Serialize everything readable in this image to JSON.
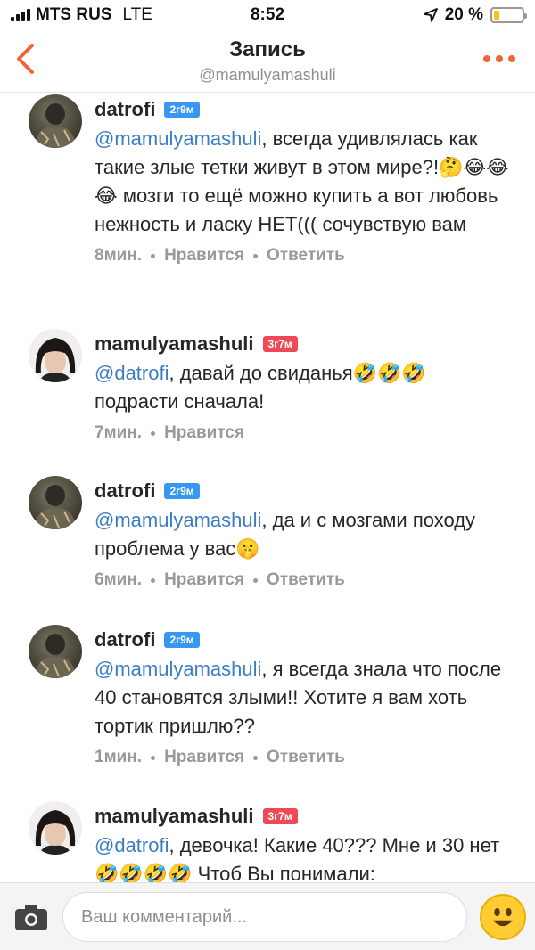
{
  "statusbar": {
    "carrier": "MTS RUS",
    "network": "LTE",
    "time": "8:52",
    "battery_text": "20 %",
    "battery_level": 0.2
  },
  "header": {
    "title": "Запись",
    "subtitle": "@mamulyamashuli"
  },
  "comments": [
    {
      "user": "datrofi",
      "badge": "2г9м",
      "badge_color": "#3897f0",
      "mention": "@mamulyamashuli",
      "text": ", всегда удивлялась как такие злые тетки живут в этом мире?!🤔😂😂😂  мозги то ещё можно купить а вот любовь нежность и ласку НЕТ((( сочувствую вам",
      "time": "8мин.",
      "like": "Нравится",
      "reply": "Ответить"
    },
    {
      "user": "mamulyamashuli",
      "badge": "3г7м",
      "badge_color": "#ed4956",
      "mention": "@datrofi",
      "text": ", давай до свиданья🤣🤣🤣 подрасти сначала!",
      "time": "7мин.",
      "like": "Нравится",
      "reply": ""
    },
    {
      "user": "datrofi",
      "badge": "2г9м",
      "badge_color": "#3897f0",
      "mention": "@mamulyamashuli",
      "text": ", да и с мозгами походу проблема у вас🤫",
      "time": "6мин.",
      "like": "Нравится",
      "reply": "Ответить"
    },
    {
      "user": "datrofi",
      "badge": "2г9м",
      "badge_color": "#3897f0",
      "mention": "@mamulyamashuli",
      "text": ", я всегда знала что после 40 становятся злыми!! Хотите я вам хоть тортик пришлю??",
      "time": "1мин.",
      "like": "Нравится",
      "reply": "Ответить"
    },
    {
      "user": "mamulyamashuli",
      "badge": "3г7м",
      "badge_color": "#ed4956",
      "mention": "@datrofi",
      "text": ", девочка! Какие 40??? Мне и 30 нет🤣🤣🤣🤣 Чтоб Вы понимали:",
      "time": "",
      "like": "",
      "reply": ""
    }
  ],
  "composer": {
    "placeholder": "Ваш комментарий..."
  },
  "colors": {
    "accent": "#f0643a",
    "mention": "#3b7dc4"
  },
  "icons": [
    "back-arrow-icon",
    "more-dots-icon",
    "camera-icon",
    "emoji-icon",
    "location-arrow-icon"
  ]
}
